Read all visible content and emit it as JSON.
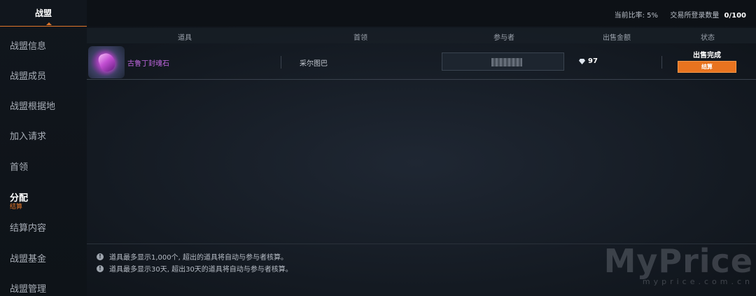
{
  "sidebar": {
    "tab_label": "战盟",
    "items": [
      {
        "label": "战盟信息"
      },
      {
        "label": "战盟成员"
      },
      {
        "label": "战盟根据地"
      },
      {
        "label": "加入请求"
      },
      {
        "label": "首领"
      },
      {
        "label": "分配",
        "sub_label": "结算"
      },
      {
        "label": "结算内容"
      },
      {
        "label": "战盟基金"
      },
      {
        "label": "战盟管理"
      }
    ],
    "active_index": 5
  },
  "topbar": {
    "rate": "当前比率: 5%",
    "count_label": "交易所登录数量",
    "count_value": "0/100"
  },
  "table": {
    "columns": [
      "道具",
      "首领",
      "参与者",
      "出售金额",
      "状态"
    ],
    "rows": [
      {
        "item_name": "古鲁丁封魂石",
        "item_icon": "purple-gem-icon",
        "leader": "采尔图巴",
        "participant": "",
        "price": "97",
        "price_icon": "diamond-icon",
        "status": "出售完成",
        "action_label": "结算"
      }
    ]
  },
  "notes": [
    "道具最多显示1,000个, 超出的道具将自动与参与者核算。",
    "道具最多显示30天, 超出30天的道具将自动与参与者核算。"
  ],
  "watermark": {
    "main": "MyPrice",
    "sub": "myprice.com.cn"
  },
  "colors": {
    "accent": "#e8731f",
    "item_name": "#c067e0",
    "background": "#0f141a"
  }
}
